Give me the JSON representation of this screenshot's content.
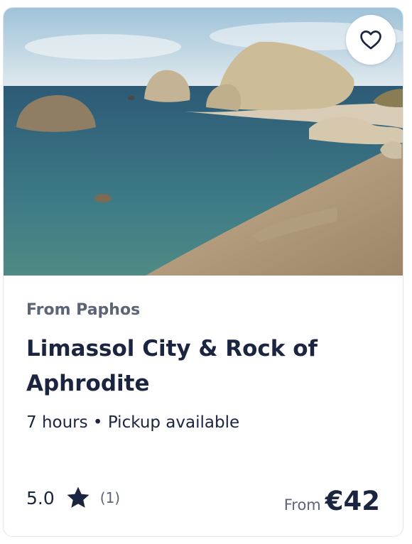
{
  "card": {
    "image_alt": "Rock of Aphrodite coastline",
    "favorite_icon": "heart-icon",
    "origin": "From Paphos",
    "title": "Limassol City & Rock of Aphrodite",
    "duration": "7 hours",
    "separator": "•",
    "pickup": "Pickup available",
    "rating": {
      "score": "5.0",
      "icon": "star-icon",
      "count": "(1)"
    },
    "price": {
      "from_label": "From",
      "amount": "€42"
    }
  },
  "colors": {
    "text_primary": "#1b2540",
    "text_secondary": "#5b6577",
    "border": "#e3e5ea"
  }
}
